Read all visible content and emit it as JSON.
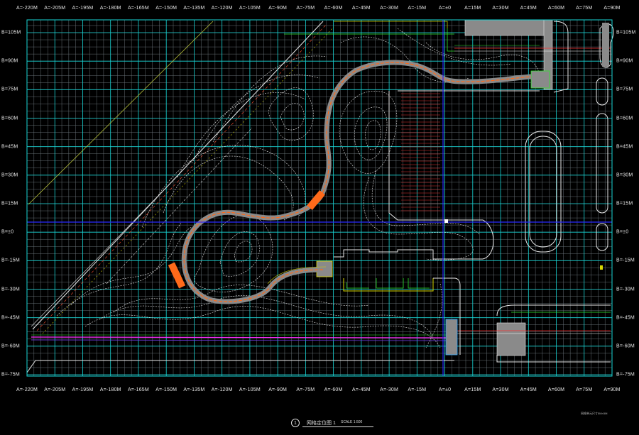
{
  "drawing": {
    "top_axis_labels": [
      "A=-220M",
      "A=-205M",
      "A=-195M",
      "A=-180M",
      "A=-165M",
      "A=-150M",
      "A=-135M",
      "A=-120M",
      "A=-105M",
      "A=-90M",
      "A=-75M",
      "A=-60M",
      "A=-45M",
      "A=-30M",
      "A=-15M",
      "A=±0",
      "A=15M",
      "A=30M",
      "A=45M",
      "A=60M",
      "A=75M",
      "A=90M"
    ],
    "bottom_axis_labels": [
      "A=-220M",
      "A=-205M",
      "A=-195M",
      "A=-180M",
      "A=-165M",
      "A=-150M",
      "A=-135M",
      "A=-120M",
      "A=-105M",
      "A=-90M",
      "A=-75M",
      "A=-60M",
      "A=-45M",
      "A=-30M",
      "A=-15M",
      "A=±0",
      "A=15M",
      "A=30M",
      "A=45M",
      "A=60M",
      "A=75M",
      "A=90M"
    ],
    "left_axis_labels": [
      "B=105M",
      "B=90M",
      "B=75M",
      "B=60M",
      "B=45M",
      "B=30M",
      "B=15M",
      "B=±0",
      "B=-15M",
      "B=-30M",
      "B=-45M",
      "B=-60M",
      "B=-75M"
    ],
    "right_axis_labels": [
      "B=105M",
      "B=90M",
      "B=75M",
      "B=60M",
      "B=45M",
      "B=30M",
      "B=15M",
      "B=±0",
      "B=-15M",
      "B=-30M",
      "B=-45M",
      "B=-60M",
      "B=-75M"
    ],
    "title_number": "1",
    "title": "网格定位图 1",
    "scale": "SCALE 1:500",
    "note": "网格单元尺寸5M×5M"
  },
  "colors": {
    "background": "#000000",
    "major_grid": "#19d6d6",
    "minor_grid": "#6f7b80",
    "axis_line": "#2a2aff",
    "boundary_yellow": "#d8d800",
    "accent_green": "#2ee82e",
    "path_red": "#e03030",
    "path_orange": "#ff6a1a",
    "paving_gray": "#8a8a8a",
    "magenta": "#ff30ff",
    "white": "#ffffff"
  }
}
